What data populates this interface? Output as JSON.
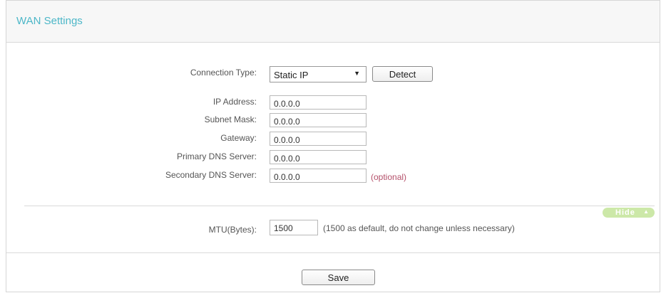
{
  "header": {
    "title": "WAN Settings"
  },
  "form": {
    "connection_type": {
      "label": "Connection Type:",
      "value": "Static IP",
      "detect_label": "Detect"
    },
    "ip_address": {
      "label": "IP Address:",
      "value": "0.0.0.0"
    },
    "subnet_mask": {
      "label": "Subnet Mask:",
      "value": "0.0.0.0"
    },
    "gateway": {
      "label": "Gateway:",
      "value": "0.0.0.0"
    },
    "primary_dns": {
      "label": "Primary DNS Server:",
      "value": "0.0.0.0"
    },
    "secondary_dns": {
      "label": "Secondary DNS Server:",
      "value": "0.0.0.0",
      "hint": "(optional)"
    }
  },
  "advanced": {
    "toggle_label": "Hide",
    "mtu": {
      "label": "MTU(Bytes):",
      "value": "1500",
      "note": "(1500 as default, do not change unless necessary)"
    }
  },
  "actions": {
    "save_label": "Save"
  },
  "colors": {
    "title": "#4db7c8",
    "optional": "#b4506a",
    "hide_pill": "#cce8a8"
  }
}
